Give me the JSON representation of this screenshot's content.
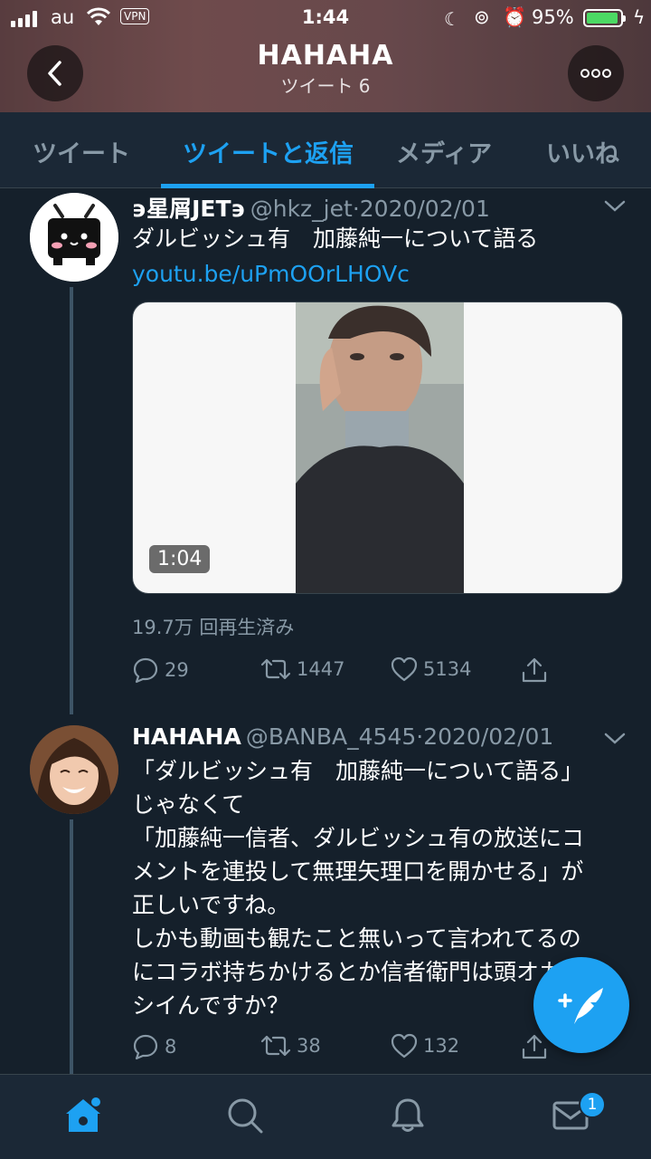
{
  "status_bar": {
    "carrier": "au",
    "vpn": "VPN",
    "time": "1:44",
    "battery_percent": "95%",
    "battery_level": 0.95
  },
  "header": {
    "title": "HAHAHA",
    "subtitle": "ツイート 6"
  },
  "tabs": [
    {
      "label": "ツイート",
      "active": false
    },
    {
      "label": "ツイートと返信",
      "active": true
    },
    {
      "label": "メディア",
      "active": false
    },
    {
      "label": "いいね",
      "active": false
    }
  ],
  "tweets": [
    {
      "name": "϶星屑JET϶",
      "handle": "@hkz_jet",
      "date": "2020/02/01",
      "text": "ダルビッシュ有　加藤純一について語る",
      "link": "youtu.be/uPmOOrLHOVc",
      "video_duration": "1:04",
      "views": "19.7万 回再生済み",
      "replies": "29",
      "retweets": "1447",
      "likes": "5134"
    },
    {
      "name": "HAHAHA",
      "handle": "@BANBA_4545",
      "date": "2020/02/01",
      "text": "「ダルビッシュ有　加藤純一について語る」\nじゃなくて\n「加藤純一信者、ダルビッシュ有の放送にコ\nメントを連投して無理矢理口を開かせる」が\n正しいですね。\nしかも動画も観たこと無いって言われてるの\nにコラボ持ちかけるとか信者衛門は頭オカ\nシイんですか？",
      "replies": "8",
      "retweets": "38",
      "likes": "132"
    }
  ],
  "bottom_nav": {
    "messages_badge": "1"
  },
  "colors": {
    "background": "#15202b",
    "accent": "#1da1f2",
    "muted": "#8899a6"
  }
}
